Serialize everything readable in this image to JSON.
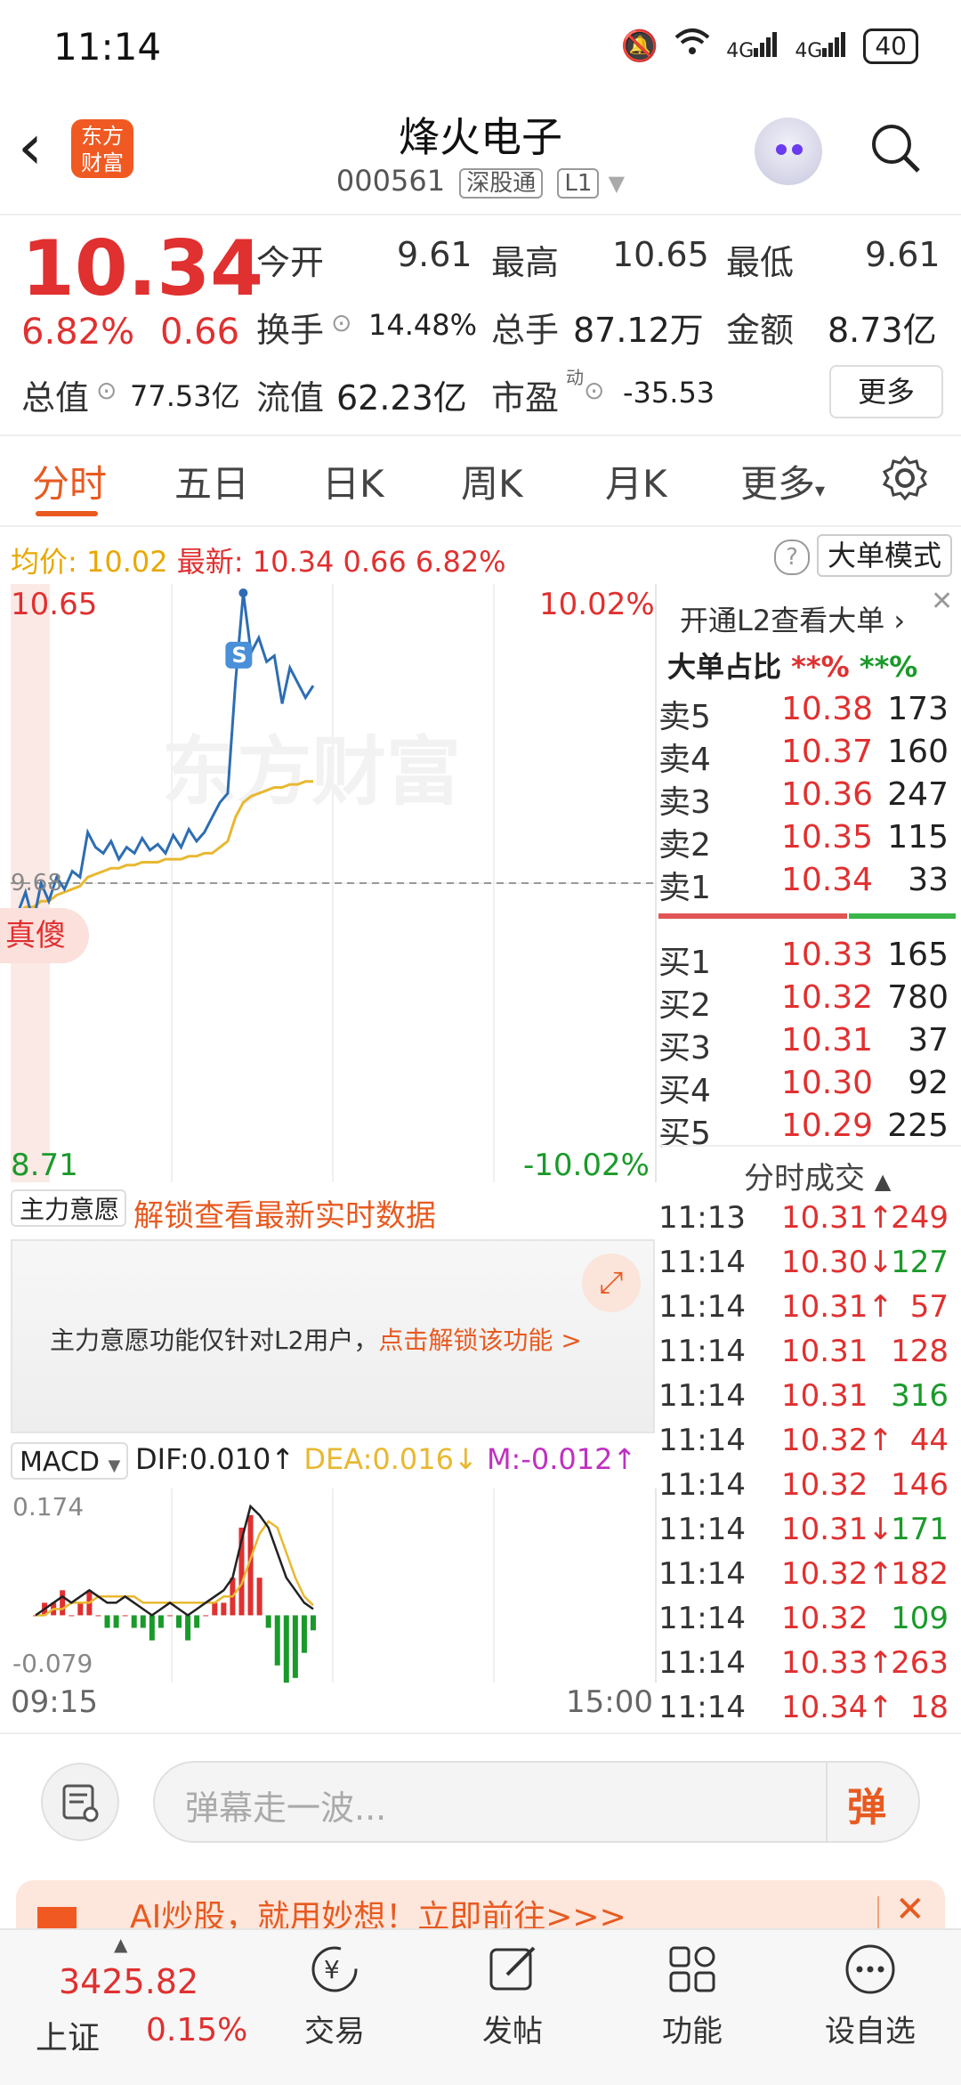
{
  "status_bar": {
    "time": "11:14",
    "icons": [
      "mute-icon",
      "wifi-icon",
      "signal-4g-icon",
      "signal-4g-icon"
    ],
    "battery": "40"
  },
  "header": {
    "stock_name": "烽火电子",
    "code": "000561",
    "tag1": "深股通",
    "tag2": "L1",
    "logo_text": "东方财富"
  },
  "quote": {
    "price": "10.34",
    "change_pct": "6.82%",
    "change_amt": "0.66",
    "open_label": "今开",
    "open": "9.61",
    "high_label": "最高",
    "high": "10.65",
    "low_label": "最低",
    "low": "9.61",
    "turnover_label": "换手",
    "turnover": "14.48%",
    "volume_label": "总手",
    "volume": "87.12万",
    "amount_label": "金额",
    "amount": "8.73亿",
    "mktcap_label": "总值",
    "mktcap": "77.53亿",
    "float_label": "流值",
    "float": "62.23亿",
    "pe_label": "市盈",
    "pe_sup": "动",
    "pe": "-35.53",
    "more_btn": "更多"
  },
  "tabs": [
    "分时",
    "五日",
    "日K",
    "周K",
    "月K",
    "更多"
  ],
  "info": {
    "avg_label": "均价:",
    "avg": "10.02",
    "latest_label": "最新:",
    "latest": "10.34",
    "chg": "0.66",
    "pct": "6.82%",
    "mode_btn": "大单模式"
  },
  "chart_labels": {
    "top_left": "10.65",
    "top_right": "10.02%",
    "bottom_left": "8.71",
    "bottom_right": "-10.02%",
    "mid_left": "9.68",
    "watermark": "东方财富",
    "bubble": "真傻",
    "marker": "S"
  },
  "mainforce": {
    "dropdown": "主力意愿",
    "unlock": "解锁查看最新实时数据",
    "notice": "主力意愿功能仅针对L2用户，",
    "notice_link": "点击解锁该功能 >"
  },
  "macd": {
    "dropdown": "MACD",
    "dif": "DIF:0.010↑",
    "dea": "DEA:0.016↓",
    "m": "M:-0.012↑",
    "top": "0.174",
    "bottom": "-0.079",
    "start_time": "09:15",
    "end_time": "15:00"
  },
  "chart_data": {
    "type": "line",
    "title": "",
    "x_range": [
      "09:15",
      "15:00"
    ],
    "ylim": [
      8.71,
      10.65
    ],
    "y_right_pct": [
      "10.02%",
      "-10.02%"
    ],
    "prev_close": 9.68,
    "series": [
      {
        "values": [
          9.58,
          9.65,
          9.55,
          9.68,
          9.62,
          9.7,
          9.66,
          9.72,
          9.7,
          9.85,
          9.8,
          9.78,
          9.82,
          9.76,
          9.8,
          9.78,
          9.83,
          9.79,
          9.81,
          9.78,
          9.84,
          9.8,
          9.86,
          9.82,
          9.85,
          9.9,
          9.95,
          9.98,
          10.35,
          10.65,
          10.45,
          10.5,
          10.42,
          10.44,
          10.28,
          10.4,
          10.35,
          10.3,
          10.34
        ]
      },
      {
        "values": [
          9.58,
          9.6,
          9.6,
          9.62,
          9.62,
          9.64,
          9.65,
          9.66,
          9.67,
          9.7,
          9.71,
          9.72,
          9.73,
          9.73,
          9.74,
          9.74,
          9.75,
          9.75,
          9.75,
          9.76,
          9.76,
          9.76,
          9.77,
          9.77,
          9.78,
          9.78,
          9.8,
          9.82,
          9.9,
          9.95,
          9.97,
          9.98,
          9.99,
          10.0,
          10.0,
          10.01,
          10.01,
          10.02,
          10.02
        ]
      }
    ]
  },
  "macd_data": {
    "dif": [
      0.0,
      0.01,
      0.02,
      0.03,
      0.02,
      0.03,
      0.04,
      0.03,
      0.02,
      0.02,
      0.03,
      0.02,
      0.01,
      0.0,
      0.01,
      0.02,
      0.01,
      0.0,
      0.01,
      0.02,
      0.03,
      0.04,
      0.06,
      0.12,
      0.174,
      0.16,
      0.14,
      0.1,
      0.06,
      0.04,
      0.02,
      0.01
    ],
    "dea": [
      0.0,
      0.0,
      0.01,
      0.01,
      0.02,
      0.02,
      0.02,
      0.03,
      0.03,
      0.03,
      0.03,
      0.03,
      0.02,
      0.02,
      0.02,
      0.02,
      0.02,
      0.02,
      0.02,
      0.02,
      0.02,
      0.03,
      0.03,
      0.05,
      0.09,
      0.13,
      0.15,
      0.14,
      0.1,
      0.06,
      0.03,
      0.016
    ],
    "m": [
      0.0,
      0.01,
      0.01,
      0.02,
      0.0,
      0.01,
      0.02,
      0.0,
      -0.01,
      -0.01,
      0.0,
      -0.01,
      -0.01,
      -0.02,
      -0.01,
      0.0,
      -0.01,
      -0.02,
      -0.01,
      0.0,
      0.01,
      0.01,
      0.03,
      0.07,
      0.08,
      0.03,
      -0.01,
      -0.04,
      -0.06,
      -0.05,
      -0.03,
      -0.012
    ]
  },
  "orderbook": {
    "promo": "开通L2查看大单",
    "ratio_label": "大单占比",
    "ratio_red": "**%",
    "ratio_green": "**%",
    "asks": [
      {
        "label": "卖5",
        "price": "10.38",
        "vol": "173"
      },
      {
        "label": "卖4",
        "price": "10.37",
        "vol": "160"
      },
      {
        "label": "卖3",
        "price": "10.36",
        "vol": "247"
      },
      {
        "label": "卖2",
        "price": "10.35",
        "vol": "115"
      },
      {
        "label": "卖1",
        "price": "10.34",
        "vol": "33"
      }
    ],
    "bids": [
      {
        "label": "买1",
        "price": "10.33",
        "vol": "165"
      },
      {
        "label": "买2",
        "price": "10.32",
        "vol": "780"
      },
      {
        "label": "买3",
        "price": "10.31",
        "vol": "37"
      },
      {
        "label": "买4",
        "price": "10.30",
        "vol": "92"
      },
      {
        "label": "买5",
        "price": "10.29",
        "vol": "225"
      }
    ],
    "ticks_title": "分时成交",
    "ticks": [
      {
        "t": "11:13",
        "p": "10.31↑",
        "v": "249",
        "c": "red"
      },
      {
        "t": "11:14",
        "p": "10.30↓",
        "v": "127",
        "c": "green"
      },
      {
        "t": "11:14",
        "p": "10.31↑",
        "v": "57",
        "c": "red"
      },
      {
        "t": "11:14",
        "p": "10.31",
        "v": "128",
        "c": "red"
      },
      {
        "t": "11:14",
        "p": "10.31",
        "v": "316",
        "c": "green"
      },
      {
        "t": "11:14",
        "p": "10.32↑",
        "v": "44",
        "c": "red"
      },
      {
        "t": "11:14",
        "p": "10.32",
        "v": "146",
        "c": "red"
      },
      {
        "t": "11:14",
        "p": "10.31↓",
        "v": "171",
        "c": "green"
      },
      {
        "t": "11:14",
        "p": "10.32↑",
        "v": "182",
        "c": "red"
      },
      {
        "t": "11:14",
        "p": "10.32",
        "v": "109",
        "c": "green"
      },
      {
        "t": "11:14",
        "p": "10.33↑",
        "v": "263",
        "c": "red"
      },
      {
        "t": "11:14",
        "p": "10.34↑",
        "v": "18",
        "c": "red"
      }
    ]
  },
  "input": {
    "placeholder": "弹幕走一波...",
    "danmu_btn": "弹"
  },
  "banner": {
    "text": "AI炒股，就用妙想！立即前往>>>"
  },
  "bottom_nav": {
    "index_value": "3425.82",
    "index_name": "上证",
    "index_pct": "0.15%",
    "items": [
      "交易",
      "发帖",
      "功能",
      "设自选"
    ]
  },
  "colors": {
    "accent": "#e85a20",
    "up": "#e03030",
    "down": "#1a9a2a",
    "price_line": "#2d6db3",
    "avg_line": "#e8b830"
  }
}
